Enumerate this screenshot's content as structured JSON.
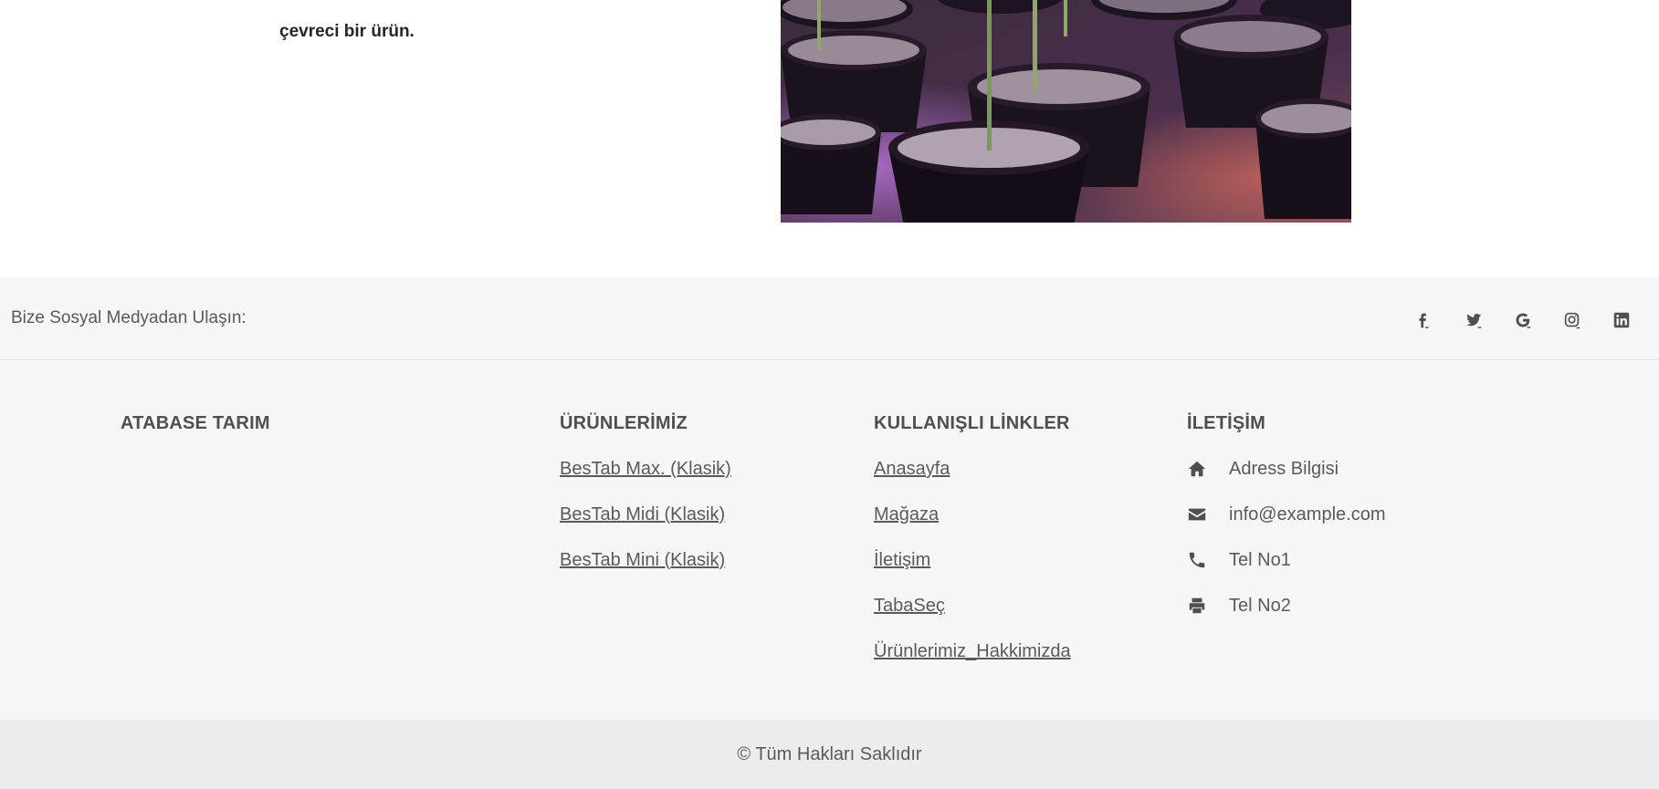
{
  "intro": {
    "text": "çevreci bir ürün."
  },
  "social_bar": {
    "label": "Bize Sosyal Medyadan Ulaşın:",
    "icons": [
      "facebook-icon",
      "twitter-icon",
      "google-icon",
      "instagram-icon",
      "linkedin-icon"
    ]
  },
  "footer": {
    "brand": "ATABASE TARIM",
    "products": {
      "title": "ÜRÜNLERİMİZ",
      "links": [
        "BesTab Max. (Klasik)",
        "BesTab Midi (Klasik)",
        "BesTab Mini (Klasik)"
      ]
    },
    "useful_links": {
      "title": "KULLANIŞLI LİNKLER",
      "links": [
        "Anasayfa",
        "Mağaza",
        "İletişim",
        "TabaSeç",
        "Ürünlerimiz_Hakkimizda"
      ]
    },
    "contact": {
      "title": "İLETİŞİM",
      "items": [
        {
          "icon": "home-icon",
          "text": "Adress Bilgisi"
        },
        {
          "icon": "envelope-icon",
          "text": "info@example.com"
        },
        {
          "icon": "phone-icon",
          "text": "Tel No1"
        },
        {
          "icon": "printer-icon",
          "text": "Tel No2"
        }
      ]
    }
  },
  "copyright": "© Tüm Hakları Saklıdır"
}
